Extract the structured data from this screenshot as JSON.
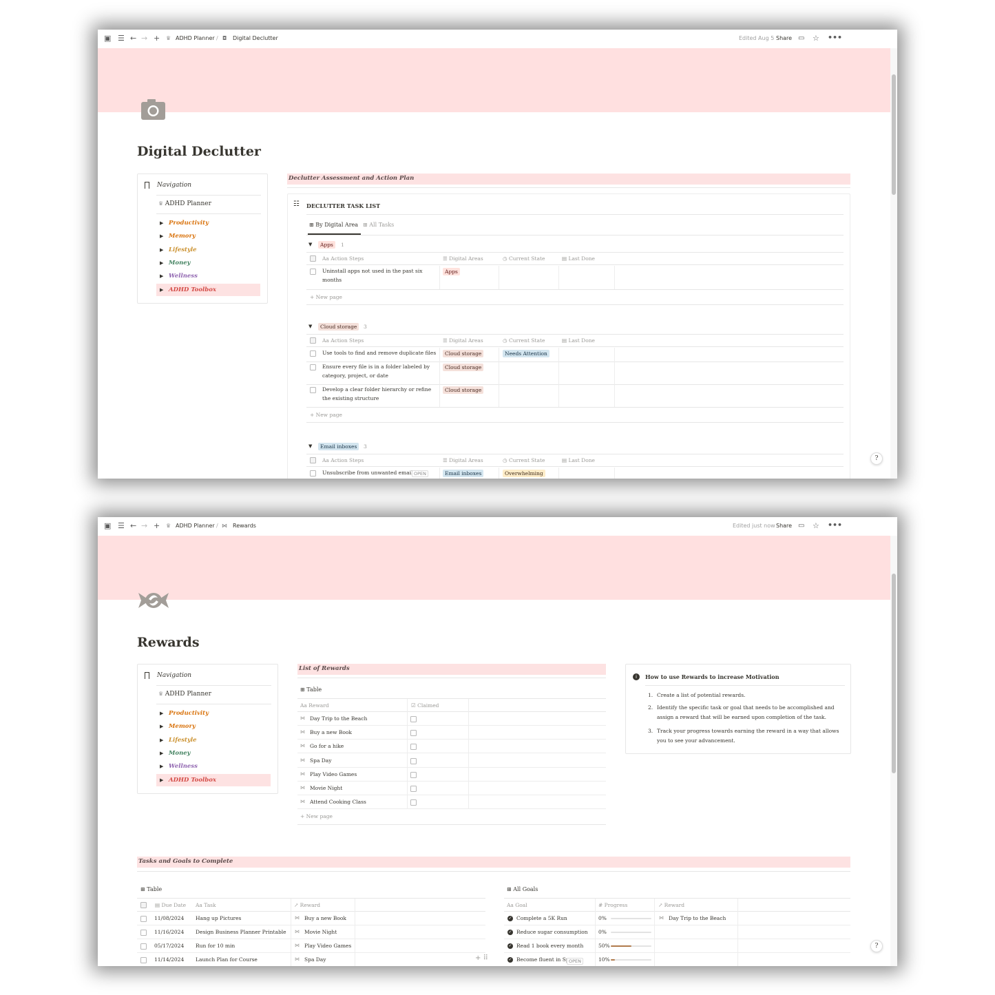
{
  "colors": {
    "cover": "#ffe0e0",
    "section_head": "#fde2e2",
    "text": "#37352f",
    "muted": "#9b9a97"
  },
  "win1": {
    "breadcrumb_1": "ADHD Planner",
    "breadcrumb_2": "Digital Declutter",
    "edited": "Edited Aug 5",
    "share": "Share",
    "page_icon": "camera-icon",
    "title": "Digital Declutter",
    "nav": {
      "heading": "Navigation",
      "home": "ADHD Planner",
      "items": [
        {
          "label": "Productivity",
          "color": "#d9730d"
        },
        {
          "label": "Memory",
          "color": "#d9730d"
        },
        {
          "label": "Lifestyle",
          "color": "#cb912f"
        },
        {
          "label": "Money",
          "color": "#448361"
        },
        {
          "label": "Wellness",
          "color": "#9065b0"
        },
        {
          "label": "ADHD Toolbox",
          "color": "#d44c47"
        }
      ]
    },
    "section_heading": "Declutter Assessment and Action Plan",
    "db_title": "DECLUTTER TASK LIST",
    "views": [
      "By Digital Area",
      "All Tasks"
    ],
    "columns": [
      "Action Steps",
      "Digital Areas",
      "Current State",
      "Last Done"
    ],
    "new_page": "New page",
    "open": "OPEN",
    "groups": [
      {
        "name": "Apps",
        "count": "1",
        "rows": [
          {
            "task": "Uninstall apps not used in the past six months",
            "area": "Apps",
            "state": ""
          }
        ]
      },
      {
        "name": "Cloud storage",
        "count": "3",
        "rows": [
          {
            "task": "Use tools to find and remove duplicate files",
            "area": "Cloud storage",
            "state": "Needs Attention"
          },
          {
            "task": "Ensure every file is in a folder labeled by category, project, or date",
            "area": "Cloud storage",
            "state": ""
          },
          {
            "task": "Develop a clear folder hierarchy or refine the existing structure",
            "area": "Cloud storage",
            "state": ""
          }
        ]
      },
      {
        "name": "Email inboxes",
        "count": "3",
        "rows": [
          {
            "task": "Unsubscribe from unwanted email",
            "area": "Email inboxes",
            "state": "Overwhelming"
          }
        ]
      }
    ]
  },
  "win2": {
    "breadcrumb_1": "ADHD Planner",
    "breadcrumb_2": "Rewards",
    "edited": "Edited just now",
    "share": "Share",
    "page_icon": "candy-icon",
    "title": "Rewards",
    "nav": {
      "heading": "Navigation",
      "home": "ADHD Planner",
      "items": [
        {
          "label": "Productivity",
          "color": "#d9730d"
        },
        {
          "label": "Memory",
          "color": "#d9730d"
        },
        {
          "label": "Lifestyle",
          "color": "#cb912f"
        },
        {
          "label": "Money",
          "color": "#448361"
        },
        {
          "label": "Wellness",
          "color": "#9065b0"
        },
        {
          "label": "ADHD Toolbox",
          "color": "#d44c47"
        }
      ]
    },
    "rewards_heading": "List of Rewards",
    "rewards_view": "Table",
    "rewards_columns": [
      "Reward",
      "Claimed"
    ],
    "rewards": [
      "Day Trip to the Beach",
      "Buy a new Book",
      "Go for a hike",
      "Spa Day",
      "Play Video Games",
      "Movie Night",
      "Attend Cooking Class"
    ],
    "new_page": "New page",
    "howto": {
      "title": "How to use Rewards to increase Motivation",
      "steps": [
        "Create a list of potential rewards.",
        "Identify the specific task or goal that needs to be accomplished and assign a reward that will be earned upon completion of the task.",
        "Track your progress towards earning the reward in a way that allows you to see your advancement."
      ]
    },
    "tasks_heading": "Tasks and Goals to Complete",
    "tasks_view": "Table",
    "tasks_columns": [
      "Due Date",
      "Task",
      "Reward"
    ],
    "tasks": [
      {
        "date": "11/08/2024",
        "task": "Hang up Pictures",
        "reward": "Buy a new Book"
      },
      {
        "date": "11/16/2024",
        "task": "Design Business Planner Printable",
        "reward": "Movie Night"
      },
      {
        "date": "05/17/2024",
        "task": "Run for 10 min",
        "reward": "Play Video Games"
      },
      {
        "date": "11/14/2024",
        "task": "Launch Plan for Course",
        "reward": "Spa Day"
      }
    ],
    "goals_view": "All Goals",
    "goals_columns": [
      "Goal",
      "Progress",
      "Reward"
    ],
    "goals": [
      {
        "goal": "Complete a 5K Run",
        "progress": "0%",
        "pct": 0,
        "reward": "Day Trip to the Beach"
      },
      {
        "goal": "Reduce sugar consumption",
        "progress": "0%",
        "pct": 0,
        "reward": ""
      },
      {
        "goal": "Read 1 book every month",
        "progress": "50%",
        "pct": 50,
        "reward": ""
      },
      {
        "goal": "Become fluent in Sp",
        "progress": "10%",
        "pct": 10,
        "reward": ""
      }
    ],
    "open": "OPEN"
  }
}
